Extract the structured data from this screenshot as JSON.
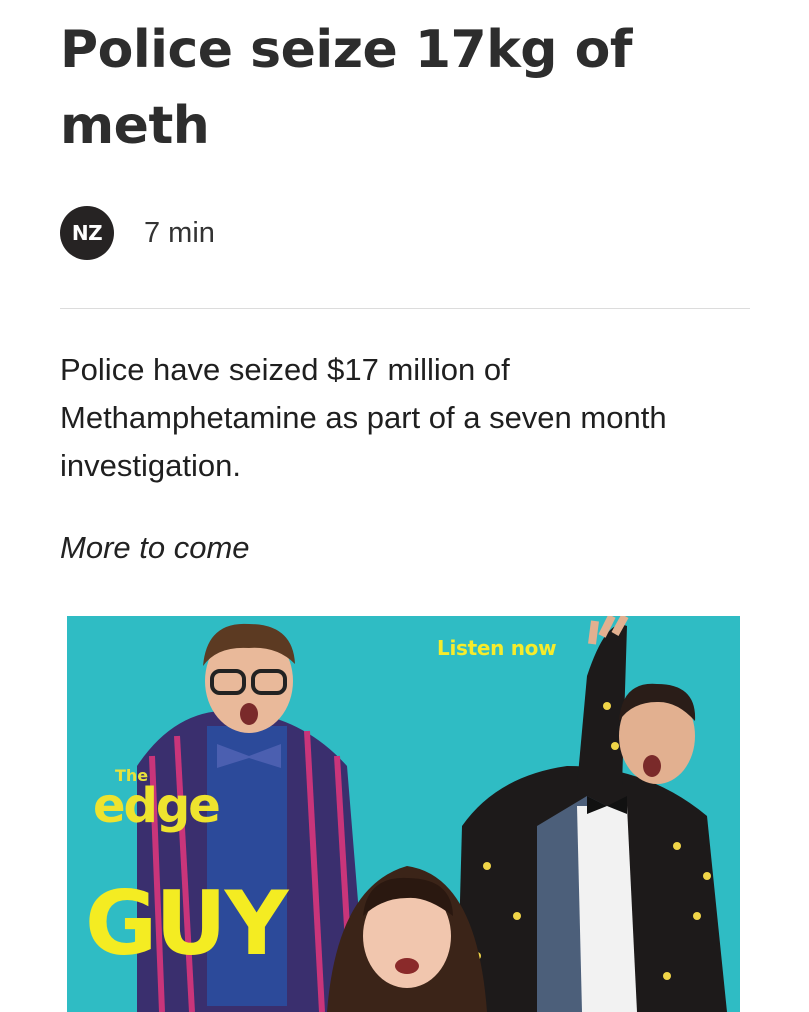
{
  "article": {
    "headline": "Police seize 17kg of meth",
    "source_badge": "NZ",
    "read_time": "7 min",
    "body": "Police have seized $17 million of Methamphetamine as part of a seven month investigation.",
    "note": "More to come"
  },
  "promo": {
    "cta": "Listen now",
    "brand_prefix": "The",
    "brand": "edge",
    "show_title": "GUY"
  },
  "colors": {
    "promo_background": "#2fbcc4",
    "promo_yellow": "#f4ec22"
  }
}
